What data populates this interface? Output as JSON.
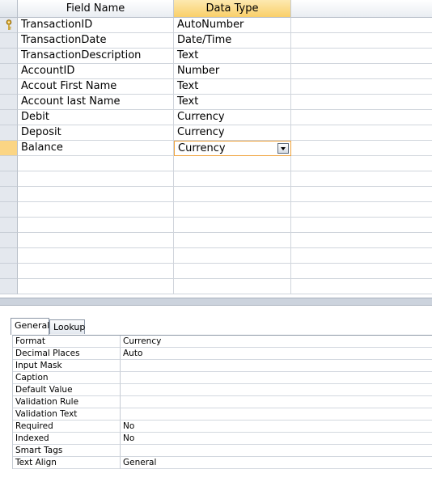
{
  "design_grid": {
    "columns": {
      "field_name": "Field Name",
      "data_type": "Data Type"
    },
    "rows": [
      {
        "field": "TransactionID",
        "type": "AutoNumber",
        "primary_key": true
      },
      {
        "field": "TransactionDate",
        "type": "Date/Time"
      },
      {
        "field": "TransactionDescription",
        "type": "Text"
      },
      {
        "field": "AccountID",
        "type": "Number"
      },
      {
        "field": "Accout First Name",
        "type": "Text"
      },
      {
        "field": "Account last Name",
        "type": "Text"
      },
      {
        "field": "Debit",
        "type": "Currency"
      },
      {
        "field": "Deposit",
        "type": "Currency"
      },
      {
        "field": "Balance",
        "type": "Currency",
        "current": true
      }
    ],
    "empty_row_count": 9,
    "colors": {
      "active_header": "#f9cf6a",
      "current_row_selector": "#fbd584",
      "current_cell_border": "#f0a33c"
    }
  },
  "properties": {
    "tabs": [
      {
        "label": "General",
        "active": true
      },
      {
        "label": "Lookup",
        "active": false
      }
    ],
    "rows": [
      {
        "name": "Format",
        "value": "Currency"
      },
      {
        "name": "Decimal Places",
        "value": "Auto"
      },
      {
        "name": "Input Mask",
        "value": ""
      },
      {
        "name": "Caption",
        "value": ""
      },
      {
        "name": "Default Value",
        "value": ""
      },
      {
        "name": "Validation Rule",
        "value": ""
      },
      {
        "name": "Validation Text",
        "value": ""
      },
      {
        "name": "Required",
        "value": "No"
      },
      {
        "name": "Indexed",
        "value": "No"
      },
      {
        "name": "Smart Tags",
        "value": ""
      },
      {
        "name": "Text Align",
        "value": "General"
      }
    ]
  }
}
